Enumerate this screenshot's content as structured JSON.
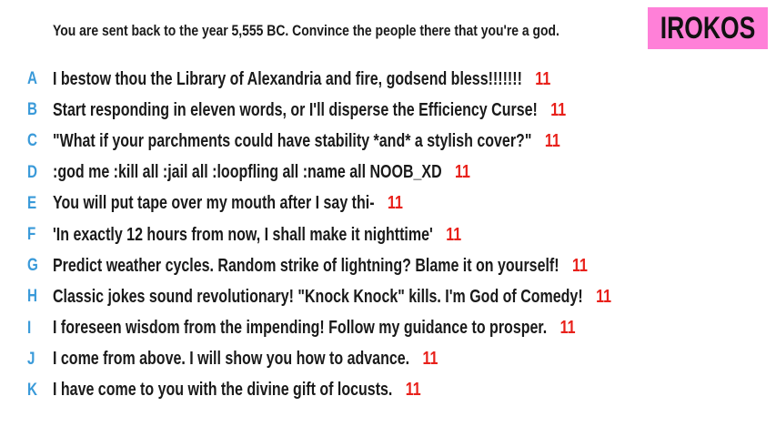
{
  "prompt": "You are sent back to the year 5,555 BC. Convince the people there that you're a god.",
  "player": {
    "name": "IROKOS",
    "badge_color": "#ff80d8"
  },
  "colors": {
    "letter": "#3a9ad9",
    "score": "#e8201a",
    "text": "#1a1a1a"
  },
  "answers": [
    {
      "letter": "A",
      "text": "I bestow thou the Library of Alexandria and fire, godsend bless!!!!!!!",
      "score": "11"
    },
    {
      "letter": "B",
      "text": "Start responding in eleven words, or I'll disperse the Efficiency Curse!",
      "score": "11"
    },
    {
      "letter": "C",
      "text": "\"What if your parchments could have stability *and* a stylish cover?\"",
      "score": "11"
    },
    {
      "letter": "D",
      "text": ":god me :kill all :jail all :loopfling all :name all NOOB_XD",
      "score": "11"
    },
    {
      "letter": "E",
      "text": "You will put tape over my mouth after I say thi-",
      "score": "11"
    },
    {
      "letter": "F",
      "text": "'In exactly 12 hours from now, I shall make it nighttime'",
      "score": "11"
    },
    {
      "letter": "G",
      "text": "Predict weather cycles. Random strike of lightning? Blame it on yourself!",
      "score": "11"
    },
    {
      "letter": "H",
      "text": "Classic jokes sound revolutionary! \"Knock Knock\" kills. I'm God of Comedy!",
      "score": "11"
    },
    {
      "letter": "I",
      "text": "I foreseen wisdom from the impending! Follow my guidance to prosper.",
      "score": "11"
    },
    {
      "letter": "J",
      "text": "I come from above. I will show you how to advance.",
      "score": "11"
    },
    {
      "letter": "K",
      "text": "I have come to you with the divine gift of locusts.",
      "score": "11"
    }
  ]
}
